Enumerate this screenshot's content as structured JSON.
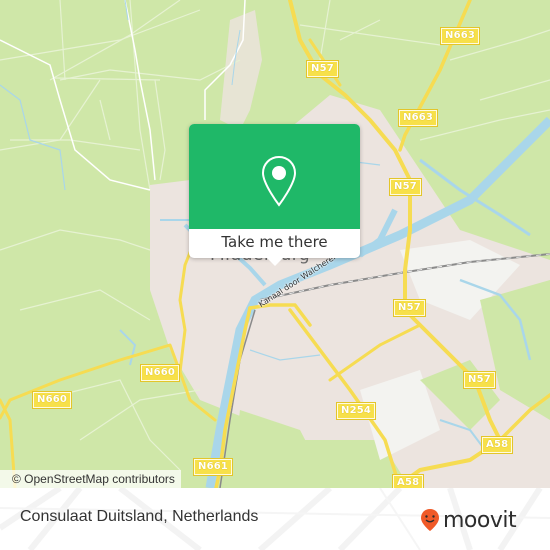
{
  "map": {
    "city_label": "Middelburg",
    "canal_label": "Kanaal door Walcheren",
    "road_labels": [
      {
        "id": "n57-top",
        "text": "N57"
      },
      {
        "id": "n663",
        "text": "N663"
      },
      {
        "id": "n57-mid",
        "text": "N57"
      },
      {
        "id": "n57-east",
        "text": "N57"
      },
      {
        "id": "n57-southeast",
        "text": "N57"
      },
      {
        "id": "n254",
        "text": "N254"
      },
      {
        "id": "a58-right",
        "text": "A58"
      },
      {
        "id": "a58-bottom",
        "text": "A58"
      },
      {
        "id": "n660-east",
        "text": "N660"
      },
      {
        "id": "n660-west",
        "text": "N660"
      },
      {
        "id": "n661",
        "text": "N661"
      }
    ],
    "colors": {
      "land": "#cfe7a8",
      "urban": "#ece4df",
      "water": "#a9d6ea",
      "road": "#f6dc52",
      "popup_green": "#1fb868"
    }
  },
  "popup": {
    "icon": "location-pin-icon",
    "button_label": "Take me there"
  },
  "attribution": "© OpenStreetMap contributors",
  "footer": {
    "place_name": "Consulaat Duitsland, Netherlands",
    "brand": "moovit",
    "brand_color": "#f05a28"
  }
}
